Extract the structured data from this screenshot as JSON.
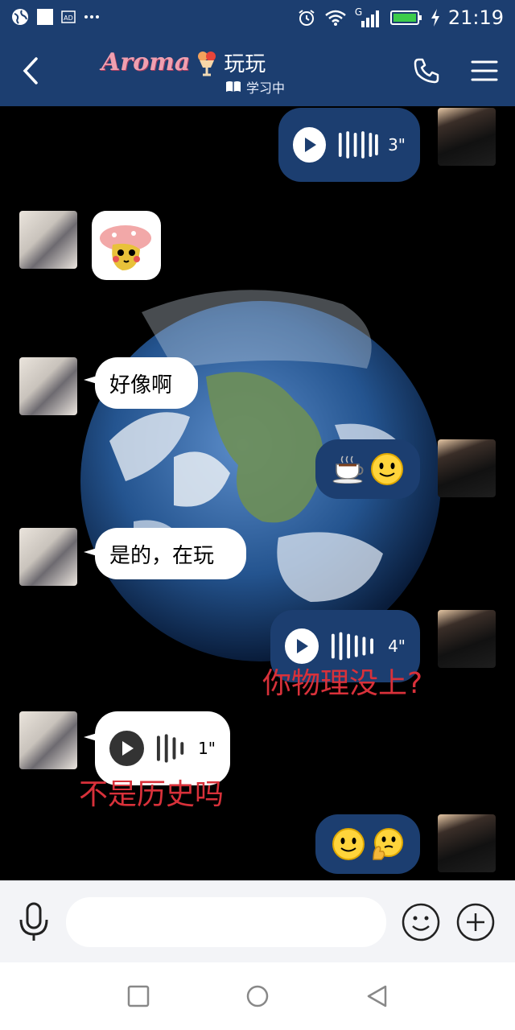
{
  "status_bar": {
    "time": "21:19",
    "network_label": "G",
    "left_icons": [
      "globe-icon",
      "white-square-icon",
      "ad-icon",
      "more-dots-icon"
    ],
    "right_icons": [
      "alarm-icon",
      "wifi-icon",
      "signal-icon",
      "battery-icon",
      "charging-icon"
    ]
  },
  "header": {
    "brand": "Aroma",
    "contact_name": "玩玩",
    "status_text": "学习中"
  },
  "messages": [
    {
      "side": "right",
      "kind": "voice",
      "duration": "3\""
    },
    {
      "side": "left",
      "kind": "sticker",
      "sticker": "mushroom-sticker"
    },
    {
      "side": "left",
      "kind": "text",
      "text": "好像啊"
    },
    {
      "side": "right",
      "kind": "emoji",
      "emoji": "☕🙂"
    },
    {
      "side": "left",
      "kind": "text",
      "text": "是的，在玩"
    },
    {
      "side": "right",
      "kind": "voice",
      "duration": "4\"",
      "overlay": "你物理没上?"
    },
    {
      "side": "left",
      "kind": "voice",
      "duration": "1\"",
      "overlay": "不是历史吗"
    },
    {
      "side": "right",
      "kind": "emoji",
      "emoji": "🙂🤔"
    }
  ],
  "input": {
    "placeholder": ""
  },
  "colors": {
    "header_bg": "#1c3e70",
    "bubble_dark": "#1c3e70",
    "overlay_red": "#d8313a"
  }
}
